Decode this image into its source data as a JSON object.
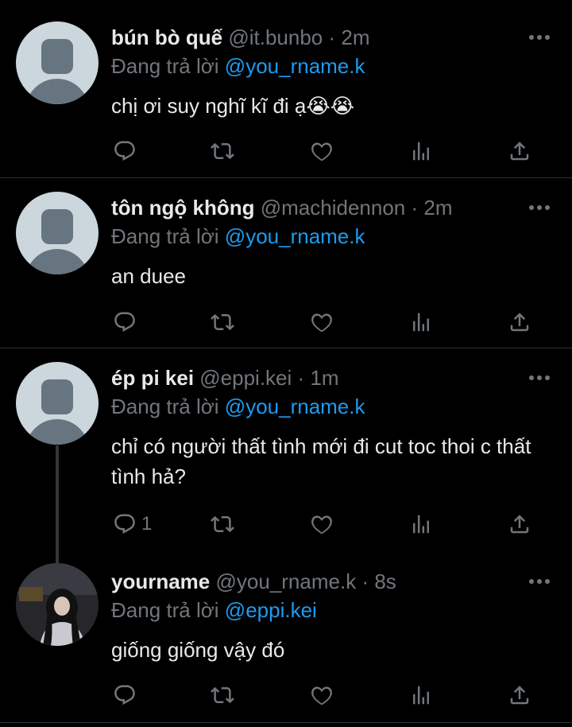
{
  "tweets": [
    {
      "name": "bún bò quế",
      "handle": "@it.bunbo",
      "dot": "·",
      "time": "2m",
      "reply_prefix": "Đang trả lời",
      "reply_to": "@you_rname.k",
      "text": "chị ơi suy nghĩ kĩ đi ạ😭😭",
      "reply_count": ""
    },
    {
      "name": "tôn ngộ không",
      "handle": "@machidennon",
      "dot": "·",
      "time": "2m",
      "reply_prefix": "Đang trả lời",
      "reply_to": "@you_rname.k",
      "text": "an duee",
      "reply_count": ""
    },
    {
      "name": "ép pi kei",
      "handle": "@eppi.kei",
      "dot": "·",
      "time": "1m",
      "reply_prefix": "Đang trả lời",
      "reply_to": "@you_rname.k",
      "text": "chỉ có người thất tình mới đi cut toc thoi c thất tình hả?",
      "reply_count": "1"
    },
    {
      "name": "yourname",
      "handle": "@you_rname.k",
      "dot": "·",
      "time": "8s",
      "reply_prefix": "Đang trả lời",
      "reply_to": "@eppi.kei",
      "text": "giống giống vậy đó",
      "reply_count": ""
    }
  ],
  "colors": {
    "background": "#000000",
    "text": "#e7e9ea",
    "muted": "#71767b",
    "accent": "#1d9bf0",
    "divider": "#2f3336"
  },
  "icons": [
    "more-icon",
    "reply-icon",
    "retweet-icon",
    "like-icon",
    "views-icon",
    "share-icon"
  ]
}
